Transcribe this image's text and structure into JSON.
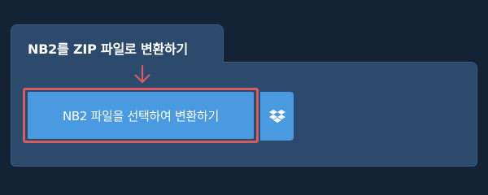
{
  "tab": {
    "title": "NB2를 ZIP 파일로 변환하기"
  },
  "convert_button": {
    "label": "NB2 파일을 선택하여 변환하기"
  },
  "dropbox_button": {
    "icon": "dropbox-icon"
  },
  "colors": {
    "background": "#132235",
    "panel": "#2c4a6b",
    "button": "#4a9ae1",
    "highlight": "#d75b5f"
  }
}
